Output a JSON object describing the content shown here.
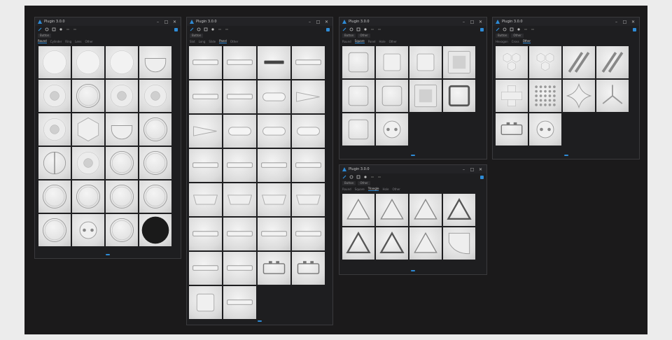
{
  "colors": {
    "accent": "#2e8bd6",
    "window_bg": "#1e1e20",
    "tile": "#e0e0e0"
  },
  "windows": [
    {
      "title": "Plugin 3.0.0",
      "chips": [
        "Button"
      ],
      "categories": [
        "Round",
        "Cylinder",
        "Ring",
        "Lens",
        "Other"
      ],
      "active_category": "Round"
    },
    {
      "title": "Plugin 3.0.0",
      "chips": [
        "Button"
      ],
      "categories": [
        "Slot",
        "Long",
        "Slide",
        "Panel",
        "Other"
      ],
      "active_category": "Panel"
    },
    {
      "title": "Plugin 3.0.0",
      "chips": [
        "Button",
        "Other"
      ],
      "categories": [
        "Round",
        "Square",
        "Panel",
        "Hole",
        "Other"
      ],
      "active_category": "Square"
    },
    {
      "title": "Plugin 3.0.0",
      "chips": [
        "Button",
        "Other"
      ],
      "categories": [
        "Hexagon",
        "Cross",
        "Other"
      ],
      "active_category": "Other"
    },
    {
      "title": "Plugin 3.0.0",
      "chips": [
        "Button",
        "Other"
      ],
      "categories": [
        "Round",
        "Square",
        "Triangle",
        "Hole",
        "Other"
      ],
      "active_category": "Triangle"
    }
  ]
}
